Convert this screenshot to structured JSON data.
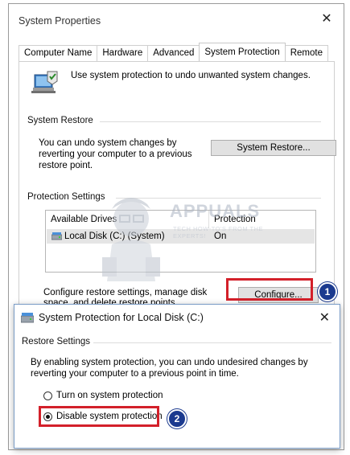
{
  "window": {
    "title": "System Properties",
    "close_glyph": "✕"
  },
  "tabs": [
    {
      "label": "Computer Name",
      "active": false
    },
    {
      "label": "Hardware",
      "active": false
    },
    {
      "label": "Advanced",
      "active": false
    },
    {
      "label": "System Protection",
      "active": true
    },
    {
      "label": "Remote",
      "active": false
    }
  ],
  "intro_text": "Use system protection to undo unwanted system changes.",
  "system_restore": {
    "group_label": "System Restore",
    "description": "You can undo system changes by reverting your computer to a previous restore point.",
    "button_label": "System Restore..."
  },
  "protection_settings": {
    "group_label": "Protection Settings",
    "columns": [
      "Available Drives",
      "Protection"
    ],
    "rows": [
      {
        "drive": "Local Disk (C:) (System)",
        "protection": "On",
        "icon": "drive-icon"
      }
    ],
    "config_text": "Configure restore settings, manage disk space, and delete restore points.",
    "configure_label": "Configure..."
  },
  "watermark": {
    "brand": "APPUALS",
    "tagline": "TECH HOW-TO'S FROM THE EXPERTS!"
  },
  "annotations": {
    "badge_1": "1",
    "badge_2": "2",
    "highlight_color": "#d3202a",
    "badge_color": "#1b3a8f"
  },
  "dialog": {
    "title": "System Protection for Local Disk (C:)",
    "close_glyph": "✕",
    "group_label": "Restore Settings",
    "description": "By enabling system protection, you can undo undesired changes by reverting your computer to a previous point in time.",
    "options": [
      {
        "label": "Turn on system protection",
        "checked": false
      },
      {
        "label": "Disable system protection",
        "checked": true
      }
    ]
  }
}
